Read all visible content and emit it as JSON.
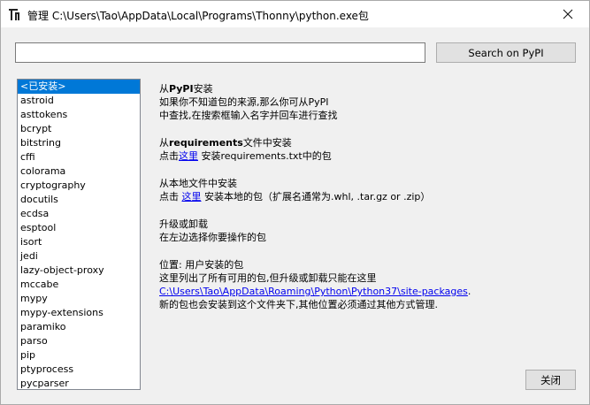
{
  "window": {
    "title": "管理 C:\\Users\\Tao\\AppData\\Local\\Programs\\Thonny\\python.exe包"
  },
  "search": {
    "value": "",
    "button_label": "Search on PyPI"
  },
  "packages": [
    "<已安装>",
    "astroid",
    "asttokens",
    "bcrypt",
    "bitstring",
    "cffi",
    "colorama",
    "cryptography",
    "docutils",
    "ecdsa",
    "esptool",
    "isort",
    "jedi",
    "lazy-object-proxy",
    "mccabe",
    "mypy",
    "mypy-extensions",
    "paramiko",
    "parso",
    "pip",
    "ptyprocess",
    "pycparser"
  ],
  "selected_package_index": 0,
  "info": {
    "pypi": {
      "heading_prefix": "从",
      "heading_bold": "PyPI",
      "heading_suffix": "安装",
      "line1": "如果你不知道包的来源,那么你可从PyPI",
      "line2": "中查找,在搜索框输入名字并回车进行查找"
    },
    "requirements": {
      "heading_prefix": "从",
      "heading_bold": "requirements",
      "heading_suffix": "文件中安装",
      "text_before": "点击",
      "link": "这里",
      "text_after": " 安装requirements.txt中的包"
    },
    "local": {
      "heading": "从本地文件中安装",
      "text_before": "点击 ",
      "link": "这里",
      "text_after": " 安装本地的包（扩展名通常为.whl, .tar.gz or .zip）"
    },
    "upgrade": {
      "heading": "升级或卸载",
      "line": "在左边选择你要操作的包"
    },
    "location": {
      "heading": "位置: 用户安装的包",
      "line1": "这里列出了所有可用的包,但升级或卸载只能在这里",
      "path": "C:\\Users\\Tao\\AppData\\Roaming\\Python\\Python37\\site-packages",
      "path_suffix": ".",
      "line3": "新的包也会安装到这个文件夹下,其他位置必须通过其他方式管理."
    }
  },
  "close_button_label": "关闭"
}
